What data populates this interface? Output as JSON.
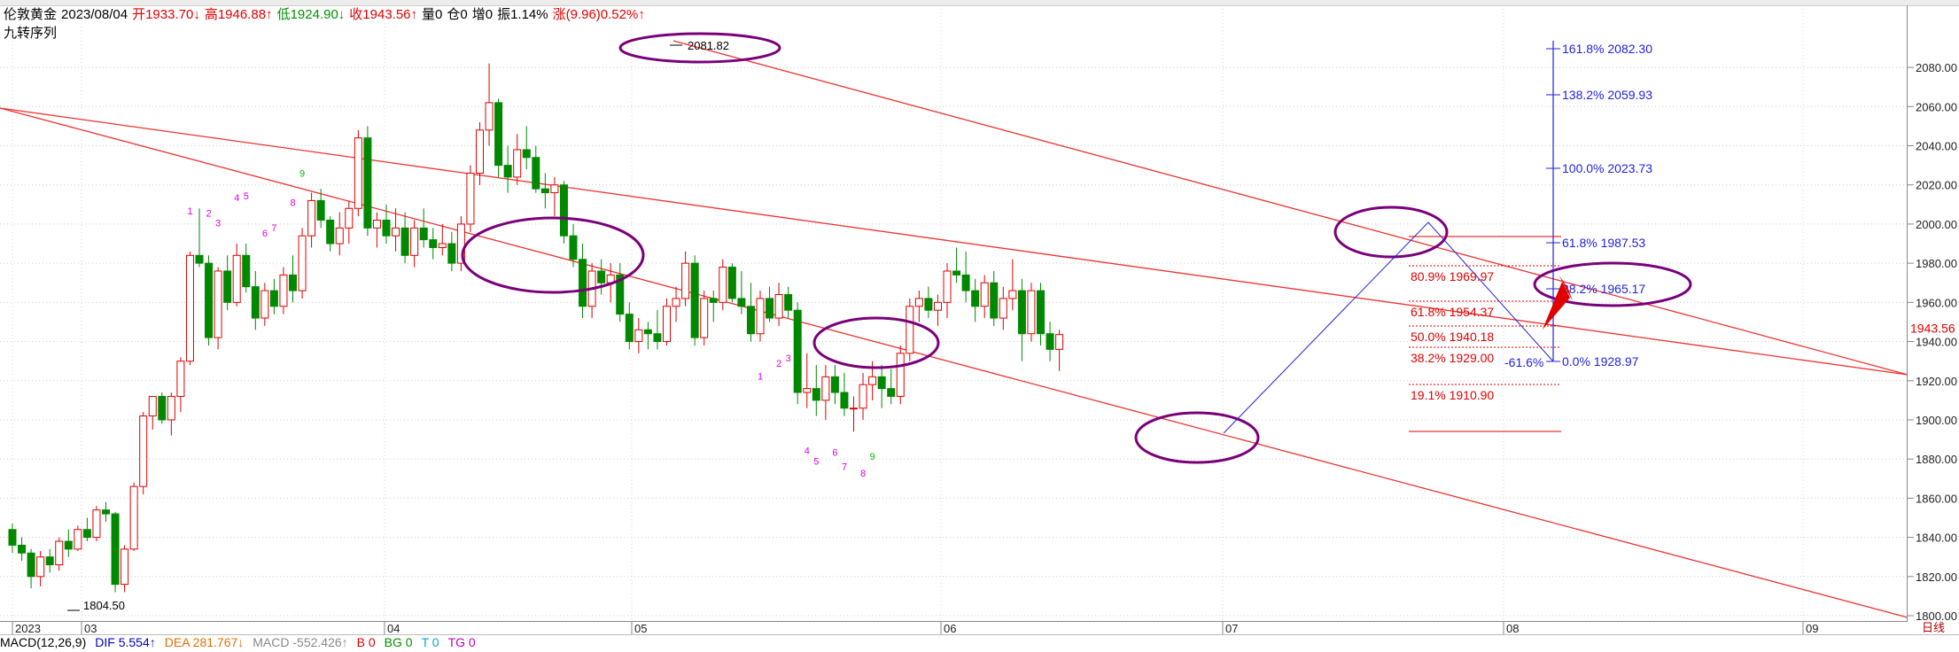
{
  "header": {
    "symbol": "伦敦黄金",
    "date": "2023/08/04",
    "open": "开1933.70↓",
    "high": "高1946.88↑",
    "low": "低1924.90↓",
    "close": "收1943.56↑",
    "volume": "量0",
    "position": "仓0",
    "increase": "增0",
    "amplitude": "振1.14%",
    "change": "涨(9.96)0.52%↑"
  },
  "indicator_name": "九转序列",
  "current_price_label": "1943.56",
  "mode_label": "日线",
  "macd": {
    "name": "MACD(12,26,9)",
    "dif": "DIF 5.554↑",
    "dea": "DEA 281.767↓",
    "macd_val": "MACD -552.426↑",
    "b": "B 0",
    "bg": "BG 0",
    "t": "T 0",
    "tg": "TG 0"
  },
  "colors": {
    "up": "#e00000",
    "down": "#008800",
    "channel": "#ee3333",
    "fib_blue": "#2222dd",
    "fib_red": "#e00000",
    "ellipse": "#7a007a",
    "seq": "#e000e0",
    "seq_nine": "#00bb00"
  },
  "chart_data": {
    "type": "candlestick",
    "ylim": [
      1800,
      2090
    ],
    "y_ticks": [
      "2080.00",
      "2060.00",
      "2040.00",
      "2020.00",
      "2000.00",
      "1980.00",
      "1960.00",
      "1940.00",
      "1920.00",
      "1900.00",
      "1880.00",
      "1860.00",
      "1840.00",
      "1820.00",
      "1800.00"
    ],
    "x_labels": [
      "2023",
      "03",
      "04",
      "05",
      "06",
      "07",
      "08",
      "09"
    ],
    "annotations": {
      "high_label": "2081.82",
      "low_label": "1804.50",
      "fib_ext": [
        "161.8% 2082.30",
        "138.2% 2059.93",
        "100.0% 2023.73",
        "61.8% 1987.53",
        "38.2% 1965.17",
        "0.0% 1928.97"
      ],
      "fib_ret": [
        "80.9% 1969.97",
        "61.8% 1954.37",
        "50.0% 1940.18",
        "38.2% 1929.00",
        "19.1% 1910.90"
      ],
      "fib_neg": "-61.6%"
    },
    "candles": [
      [
        1844,
        1847,
        1832,
        1836
      ],
      [
        1836,
        1840,
        1828,
        1832
      ],
      [
        1832,
        1834,
        1814,
        1820
      ],
      [
        1820,
        1833,
        1815,
        1830
      ],
      [
        1830,
        1834,
        1822,
        1826
      ],
      [
        1826,
        1840,
        1823,
        1838
      ],
      [
        1838,
        1844,
        1830,
        1834
      ],
      [
        1834,
        1846,
        1833,
        1844
      ],
      [
        1844,
        1850,
        1838,
        1840
      ],
      [
        1840,
        1856,
        1838,
        1854
      ],
      [
        1854,
        1858,
        1848,
        1852
      ],
      [
        1852,
        1853,
        1812,
        1816
      ],
      [
        1816,
        1836,
        1812,
        1834
      ],
      [
        1834,
        1868,
        1833,
        1866
      ],
      [
        1866,
        1904,
        1862,
        1902
      ],
      [
        1902,
        1912,
        1895,
        1912
      ],
      [
        1912,
        1914,
        1898,
        1900
      ],
      [
        1900,
        1914,
        1892,
        1912
      ],
      [
        1912,
        1932,
        1904,
        1930
      ],
      [
        1930,
        1986,
        1928,
        1984
      ],
      [
        1984,
        2008,
        1978,
        1980
      ],
      [
        1980,
        1984,
        1938,
        1942
      ],
      [
        1942,
        1978,
        1936,
        1976
      ],
      [
        1976,
        1984,
        1956,
        1960
      ],
      [
        1960,
        1990,
        1958,
        1984
      ],
      [
        1984,
        1990,
        1965,
        1968
      ],
      [
        1968,
        1976,
        1946,
        1952
      ],
      [
        1952,
        1970,
        1948,
        1966
      ],
      [
        1966,
        1972,
        1954,
        1958
      ],
      [
        1958,
        1978,
        1954,
        1974
      ],
      [
        1974,
        1984,
        1960,
        1966
      ],
      [
        1966,
        1998,
        1962,
        1994
      ],
      [
        1994,
        2016,
        1988,
        2012
      ],
      [
        2012,
        2018,
        1998,
        2002
      ],
      [
        2002,
        2004,
        1986,
        1990
      ],
      [
        1990,
        2006,
        1984,
        1998
      ],
      [
        1998,
        2012,
        1990,
        2008
      ],
      [
        2008,
        2048,
        2004,
        2044
      ],
      [
        2044,
        2050,
        1994,
        1998
      ],
      [
        1998,
        2006,
        1988,
        2002
      ],
      [
        2002,
        2010,
        1990,
        1994
      ],
      [
        1994,
        2008,
        1986,
        1998
      ],
      [
        1998,
        2006,
        1980,
        1984
      ],
      [
        1984,
        2002,
        1978,
        1998
      ],
      [
        1998,
        2008,
        1988,
        1992
      ],
      [
        1992,
        1998,
        1982,
        1988
      ],
      [
        1988,
        2000,
        1984,
        1990
      ],
      [
        1990,
        1996,
        1976,
        1980
      ],
      [
        1980,
        2004,
        1976,
        2000
      ],
      [
        2000,
        2030,
        1996,
        2026
      ],
      [
        2026,
        2052,
        2020,
        2048
      ],
      [
        2048,
        2082,
        2040,
        2062
      ],
      [
        2062,
        2064,
        2024,
        2030
      ],
      [
        2030,
        2040,
        2016,
        2024
      ],
      [
        2024,
        2046,
        2020,
        2038
      ],
      [
        2038,
        2050,
        2028,
        2034
      ],
      [
        2034,
        2040,
        2016,
        2018
      ],
      [
        2018,
        2026,
        2008,
        2016
      ],
      [
        2016,
        2024,
        2004,
        2020
      ],
      [
        2020,
        2022,
        1990,
        1994
      ],
      [
        1994,
        2000,
        1978,
        1982
      ],
      [
        1982,
        1990,
        1952,
        1958
      ],
      [
        1958,
        1980,
        1952,
        1976
      ],
      [
        1976,
        1982,
        1964,
        1970
      ],
      [
        1970,
        1980,
        1960,
        1974
      ],
      [
        1974,
        1980,
        1950,
        1954
      ],
      [
        1954,
        1960,
        1936,
        1940
      ],
      [
        1940,
        1952,
        1934,
        1946
      ],
      [
        1946,
        1950,
        1936,
        1944
      ],
      [
        1944,
        1956,
        1936,
        1940
      ],
      [
        1940,
        1962,
        1938,
        1958
      ],
      [
        1958,
        1968,
        1950,
        1962
      ],
      [
        1962,
        1986,
        1958,
        1980
      ],
      [
        1980,
        1984,
        1938,
        1942
      ],
      [
        1942,
        1966,
        1938,
        1962
      ],
      [
        1962,
        1966,
        1950,
        1960
      ],
      [
        1960,
        1982,
        1956,
        1978
      ],
      [
        1978,
        1980,
        1960,
        1962
      ],
      [
        1962,
        1976,
        1954,
        1958
      ],
      [
        1958,
        1970,
        1940,
        1944
      ],
      [
        1944,
        1966,
        1940,
        1962
      ],
      [
        1962,
        1968,
        1950,
        1952
      ],
      [
        1952,
        1970,
        1948,
        1964
      ],
      [
        1964,
        1968,
        1952,
        1956
      ],
      [
        1956,
        1960,
        1908,
        1914
      ],
      [
        1914,
        1934,
        1906,
        1916
      ],
      [
        1916,
        1928,
        1902,
        1910
      ],
      [
        1910,
        1928,
        1900,
        1922
      ],
      [
        1922,
        1928,
        1908,
        1914
      ],
      [
        1914,
        1924,
        1902,
        1906
      ],
      [
        1906,
        1912,
        1894,
        1906
      ],
      [
        1906,
        1924,
        1900,
        1918
      ],
      [
        1918,
        1930,
        1910,
        1922
      ],
      [
        1922,
        1928,
        1906,
        1916
      ],
      [
        1916,
        1926,
        1908,
        1912
      ],
      [
        1912,
        1938,
        1908,
        1934
      ],
      [
        1934,
        1962,
        1930,
        1958
      ],
      [
        1958,
        1966,
        1950,
        1962
      ],
      [
        1962,
        1968,
        1952,
        1956
      ],
      [
        1956,
        1964,
        1948,
        1960
      ],
      [
        1960,
        1980,
        1952,
        1976
      ],
      [
        1976,
        1988,
        1970,
        1974
      ],
      [
        1974,
        1986,
        1960,
        1966
      ],
      [
        1966,
        1972,
        1950,
        1958
      ],
      [
        1958,
        1974,
        1952,
        1970
      ],
      [
        1970,
        1976,
        1948,
        1952
      ],
      [
        1952,
        1968,
        1946,
        1962
      ],
      [
        1962,
        1982,
        1956,
        1966
      ],
      [
        1966,
        1972,
        1930,
        1944
      ],
      [
        1944,
        1970,
        1940,
        1966
      ],
      [
        1966,
        1970,
        1938,
        1944
      ],
      [
        1944,
        1950,
        1930,
        1936
      ],
      [
        1936,
        1946,
        1925,
        1943.56
      ]
    ],
    "td_sequence": [
      {
        "i": 19,
        "n": "1"
      },
      {
        "i": 21,
        "n": "2"
      },
      {
        "i": 22,
        "n": "3"
      },
      {
        "i": 24,
        "n": "4"
      },
      {
        "i": 25,
        "n": "5"
      },
      {
        "i": 27,
        "n": "6"
      },
      {
        "i": 28,
        "n": "7"
      },
      {
        "i": 30,
        "n": "8"
      },
      {
        "i": 31,
        "n": "9"
      },
      {
        "i": 80,
        "n": "1"
      },
      {
        "i": 82,
        "n": "2"
      },
      {
        "i": 83,
        "n": "3"
      },
      {
        "i": 85,
        "n": "4"
      },
      {
        "i": 86,
        "n": "5"
      },
      {
        "i": 88,
        "n": "6"
      },
      {
        "i": 89,
        "n": "7"
      },
      {
        "i": 91,
        "n": "8"
      },
      {
        "i": 92,
        "n": "9"
      },
      {
        "i": 125,
        "n": "1"
      },
      {
        "i": 126,
        "n": "2"
      },
      {
        "i": 128,
        "n": "3"
      },
      {
        "i": 129,
        "n": "4"
      },
      {
        "i": 131,
        "n": "5"
      },
      {
        "i": 132,
        "n": "6"
      },
      {
        "i": 134,
        "n": "7"
      },
      {
        "i": 135,
        "n": "8"
      },
      {
        "i": 136,
        "n": "9"
      },
      {
        "i": 146,
        "n": "1"
      },
      {
        "i": 148,
        "n": "2"
      },
      {
        "i": 150,
        "n": "3"
      },
      {
        "i": 151,
        "n": "4"
      },
      {
        "i": 153,
        "n": "5"
      },
      {
        "i": 154,
        "n": "6"
      },
      {
        "i": 155,
        "n": "7"
      },
      {
        "i": 157,
        "n": "8"
      },
      {
        "i": 159,
        "n": "9"
      }
    ]
  }
}
